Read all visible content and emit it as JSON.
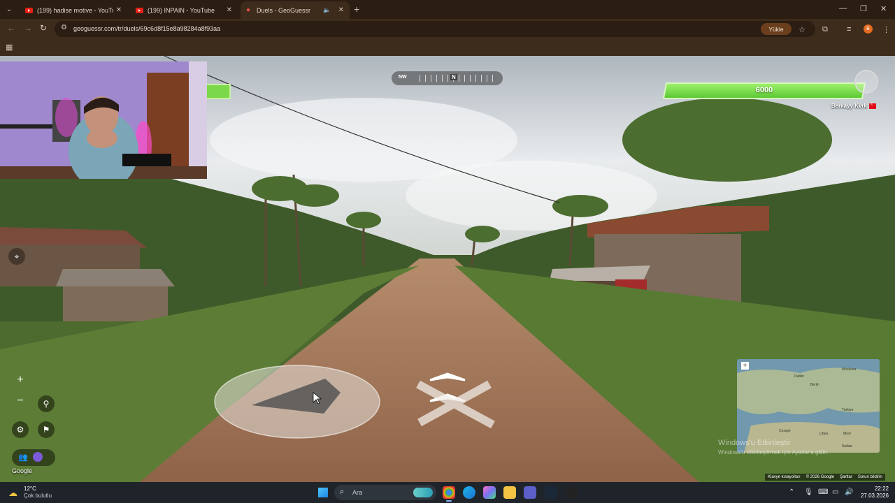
{
  "browser": {
    "tabs": [
      {
        "title": "(199) hadise motive - YouTube",
        "active": false
      },
      {
        "title": "(199) INPAIN - YouTube",
        "active": false
      },
      {
        "title": "Duels - GeoGuessr",
        "active": true
      }
    ],
    "url": "geoguessr.com/tr/duels/69c6d8f15e8a98284a8f93aa",
    "upload_label": "Yükle",
    "profile_initial": "B"
  },
  "game": {
    "compass": {
      "left": "NW",
      "center": "N"
    },
    "opponent_health": 6000,
    "player_name": "Berkayy Kvrk",
    "google_label": "Google",
    "watermark_line1": "Windows'u Etkinleştir",
    "watermark_line2": "Windows'u etkinleştirmek için Ayarlar'a gidin.",
    "attribution": [
      "Klavye kısayolları",
      "© 2026 Google",
      "Şartlar",
      "Sorun bildirin"
    ],
    "minimap_cities": [
      "Dublin",
      "Moskova",
      "Berlin",
      "Türkiye",
      "Libya",
      "Cezayir",
      "Mısır",
      "Sudan"
    ]
  },
  "taskbar": {
    "temperature": "12°C",
    "condition": "Çok bulutlu",
    "search_placeholder": "Ara",
    "time": "22:22",
    "date": "27.03.2026"
  },
  "colors": {
    "health_bar": "#6fd640",
    "chrome": "#3d2b1c",
    "taskbar": "#1f242b"
  }
}
